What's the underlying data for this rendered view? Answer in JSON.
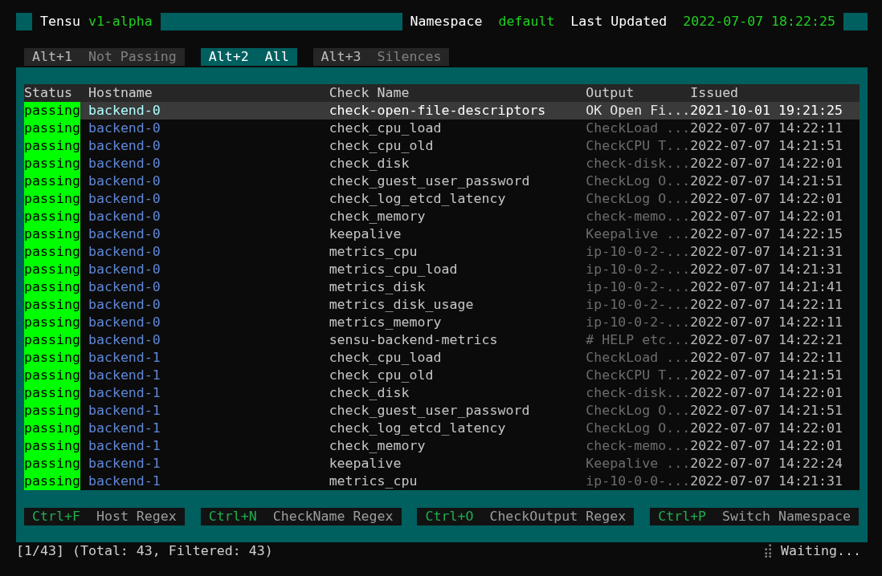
{
  "header": {
    "app": "Tensu",
    "version": "v1-alpha",
    "namespace_label": "Namespace",
    "namespace": "default",
    "updated_label": "Last Updated",
    "updated": "2022-07-07 18:22:25"
  },
  "tabs": [
    {
      "key": "Alt+1",
      "label": "Not Passing",
      "selected": false
    },
    {
      "key": "Alt+2",
      "label": "All",
      "selected": true
    },
    {
      "key": "Alt+3",
      "label": "Silences",
      "selected": false
    }
  ],
  "table": {
    "columns": [
      "Status",
      "Hostname",
      "Check Name",
      "Output",
      "Issued"
    ],
    "rows": [
      {
        "status": "passing",
        "host": "backend-0",
        "check": "check-open-file-descriptors",
        "output": "OK Open Fi...",
        "issued": "2021-10-01 19:21:25",
        "selected": true
      },
      {
        "status": "passing",
        "host": "backend-0",
        "check": "check_cpu_load",
        "output": "CheckLoad ...",
        "issued": "2022-07-07 14:22:11",
        "selected": false
      },
      {
        "status": "passing",
        "host": "backend-0",
        "check": "check_cpu_old",
        "output": "CheckCPU T...",
        "issued": "2022-07-07 14:21:51",
        "selected": false
      },
      {
        "status": "passing",
        "host": "backend-0",
        "check": "check_disk",
        "output": "check-disk...",
        "issued": "2022-07-07 14:22:01",
        "selected": false
      },
      {
        "status": "passing",
        "host": "backend-0",
        "check": "check_guest_user_password",
        "output": "CheckLog O...",
        "issued": "2022-07-07 14:21:51",
        "selected": false
      },
      {
        "status": "passing",
        "host": "backend-0",
        "check": "check_log_etcd_latency",
        "output": "CheckLog O...",
        "issued": "2022-07-07 14:22:01",
        "selected": false
      },
      {
        "status": "passing",
        "host": "backend-0",
        "check": "check_memory",
        "output": "check-memo...",
        "issued": "2022-07-07 14:22:01",
        "selected": false
      },
      {
        "status": "passing",
        "host": "backend-0",
        "check": "keepalive",
        "output": "Keepalive ...",
        "issued": "2022-07-07 14:22:15",
        "selected": false
      },
      {
        "status": "passing",
        "host": "backend-0",
        "check": "metrics_cpu",
        "output": "ip-10-0-2-...",
        "issued": "2022-07-07 14:21:31",
        "selected": false
      },
      {
        "status": "passing",
        "host": "backend-0",
        "check": "metrics_cpu_load",
        "output": "ip-10-0-2-...",
        "issued": "2022-07-07 14:21:31",
        "selected": false
      },
      {
        "status": "passing",
        "host": "backend-0",
        "check": "metrics_disk",
        "output": "ip-10-0-2-...",
        "issued": "2022-07-07 14:21:41",
        "selected": false
      },
      {
        "status": "passing",
        "host": "backend-0",
        "check": "metrics_disk_usage",
        "output": "ip-10-0-2-...",
        "issued": "2022-07-07 14:22:11",
        "selected": false
      },
      {
        "status": "passing",
        "host": "backend-0",
        "check": "metrics_memory",
        "output": "ip-10-0-2-...",
        "issued": "2022-07-07 14:22:11",
        "selected": false
      },
      {
        "status": "passing",
        "host": "backend-0",
        "check": "sensu-backend-metrics",
        "output": "# HELP etc...",
        "issued": "2022-07-07 14:22:21",
        "selected": false
      },
      {
        "status": "passing",
        "host": "backend-1",
        "check": "check_cpu_load",
        "output": "CheckLoad ...",
        "issued": "2022-07-07 14:22:11",
        "selected": false
      },
      {
        "status": "passing",
        "host": "backend-1",
        "check": "check_cpu_old",
        "output": "CheckCPU T...",
        "issued": "2022-07-07 14:21:51",
        "selected": false
      },
      {
        "status": "passing",
        "host": "backend-1",
        "check": "check_disk",
        "output": "check-disk...",
        "issued": "2022-07-07 14:22:01",
        "selected": false
      },
      {
        "status": "passing",
        "host": "backend-1",
        "check": "check_guest_user_password",
        "output": "CheckLog O...",
        "issued": "2022-07-07 14:21:51",
        "selected": false
      },
      {
        "status": "passing",
        "host": "backend-1",
        "check": "check_log_etcd_latency",
        "output": "CheckLog O...",
        "issued": "2022-07-07 14:22:01",
        "selected": false
      },
      {
        "status": "passing",
        "host": "backend-1",
        "check": "check_memory",
        "output": "check-memo...",
        "issued": "2022-07-07 14:22:01",
        "selected": false
      },
      {
        "status": "passing",
        "host": "backend-1",
        "check": "keepalive",
        "output": "Keepalive ...",
        "issued": "2022-07-07 14:22:24",
        "selected": false
      },
      {
        "status": "passing",
        "host": "backend-1",
        "check": "metrics_cpu",
        "output": "ip-10-0-0-...",
        "issued": "2022-07-07 14:21:31",
        "selected": false
      }
    ]
  },
  "shortcuts": [
    {
      "key": "Ctrl+F",
      "label": "Host Regex"
    },
    {
      "key": "Ctrl+N",
      "label": "CheckName Regex"
    },
    {
      "key": "Ctrl+O",
      "label": "CheckOutput Regex"
    },
    {
      "key": "Ctrl+P",
      "label": "Switch Namespace"
    }
  ],
  "status_bar": {
    "position": "[1/43] (Total: 43, Filtered: 43)",
    "spinner": "⣾",
    "message": "Waiting..."
  }
}
